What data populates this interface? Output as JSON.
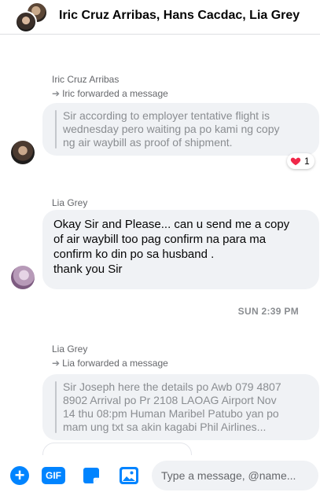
{
  "header": {
    "title": "Iric Cruz Arribas, Hans Cacdac, Lia Grey"
  },
  "messages": [
    {
      "sender": "Iric Cruz Arribas",
      "forward_note": "Iric forwarded a message",
      "text_lines": [
        "Sir according to employer tentative flight is",
        "wednesday pero waiting pa po kami ng copy",
        "ng air waybill as proof of shipment."
      ],
      "reaction": {
        "emoji": "heart",
        "count": "1"
      }
    },
    {
      "sender": "Lia Grey",
      "text_lines": [
        "Okay Sir and  Please... can u send me a copy",
        "of air waybill too pag confirm  na para ma",
        "confirm ko din po  sa husband  .",
        "thank you Sir"
      ]
    },
    {
      "timestamp": "SUN 2:39 PM"
    },
    {
      "sender": "Lia Grey",
      "forward_note": "Lia forwarded a message",
      "text_lines": [
        "Sir Joseph here the details po Awb 079 4807",
        "8902 Arrival po Pr 2108 LAOAG Airport Nov",
        "14 thu 08:pm Human Maribel Patubo yan po",
        "mam ung txt sa akin kagabi Phil Airlines..."
      ]
    }
  ],
  "composer": {
    "plus_label": "+",
    "gif_label": "GIF",
    "placeholder": "Type a message, @name..."
  },
  "colors": {
    "accent": "#0084ff",
    "bubble": "#f0f2f5",
    "muted_text": "#65676b",
    "heart": "#f02849"
  },
  "icons": [
    "plus-icon",
    "gif-icon",
    "sticker-icon",
    "image-icon",
    "heart-icon",
    "forward-arrow-icon"
  ]
}
